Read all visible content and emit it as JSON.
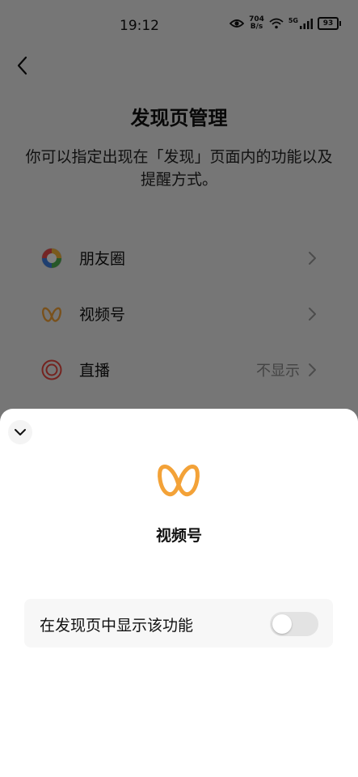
{
  "status_bar": {
    "time": "19:12",
    "net_speed_value": "704",
    "net_speed_unit": "B/s",
    "network_type": "5G",
    "battery": "93"
  },
  "page": {
    "title": "发现页管理",
    "description": "你可以指定出现在「发现」页面内的功能以及提醒方式。",
    "items": [
      {
        "label": "朋友圈",
        "value": "",
        "icon": "moments-icon"
      },
      {
        "label": "视频号",
        "value": "",
        "icon": "channels-icon"
      },
      {
        "label": "直播",
        "value": "不显示",
        "icon": "live-icon"
      }
    ]
  },
  "sheet": {
    "title": "视频号",
    "toggle_label": "在发现页中显示该功能",
    "toggle_on": false
  },
  "colors": {
    "channels_orange": "#f3a238",
    "live_red": "#e8473f",
    "toggle_off": "#e3e3e3"
  }
}
